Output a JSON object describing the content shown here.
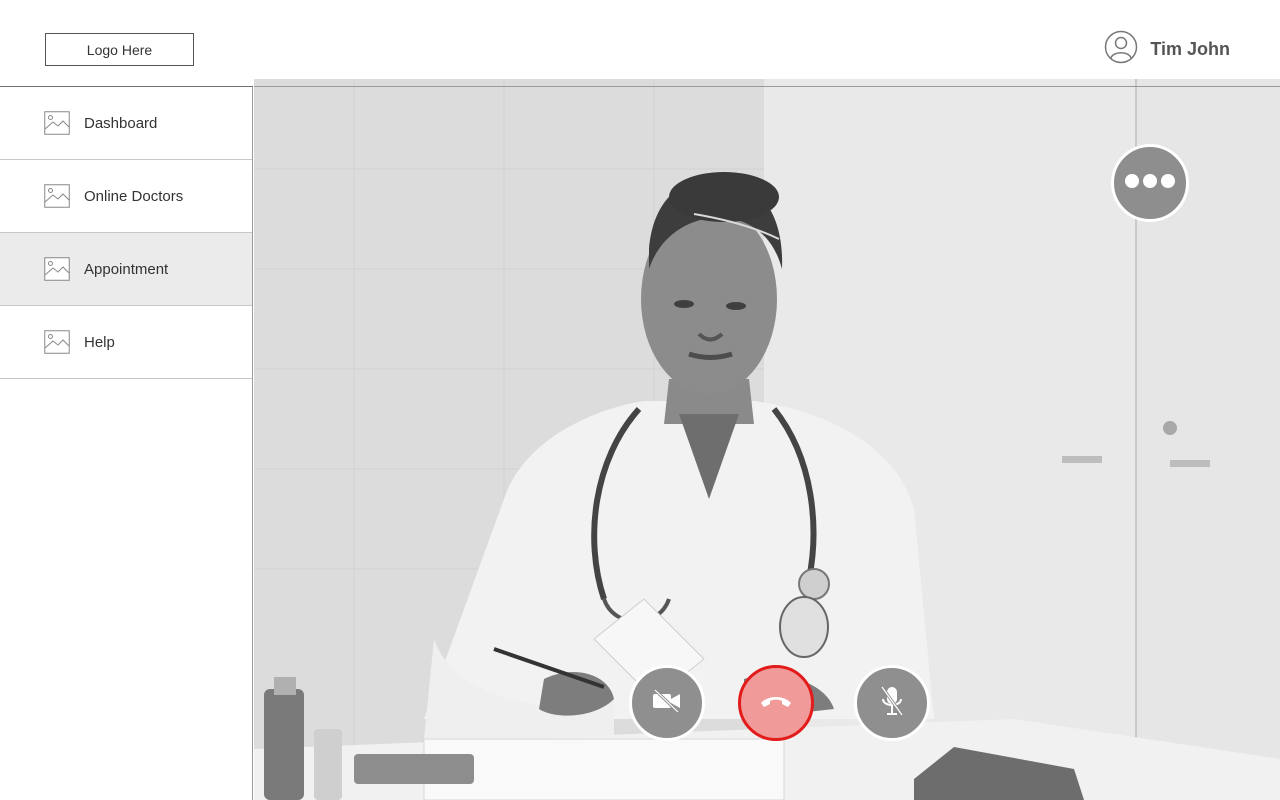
{
  "header": {
    "logo_text": "Logo Here",
    "user": {
      "name": "Tim John",
      "avatar_icon": "user-avatar-icon"
    }
  },
  "sidebar": {
    "items": [
      {
        "label": "Dashboard",
        "icon": "image-placeholder-icon",
        "active": false
      },
      {
        "label": "Online Doctors",
        "icon": "image-placeholder-icon",
        "active": false
      },
      {
        "label": "Appointment",
        "icon": "image-placeholder-icon",
        "active": true
      },
      {
        "label": "Help",
        "icon": "image-placeholder-icon",
        "active": false
      }
    ]
  },
  "call": {
    "more_icon": "more-options-icon",
    "controls": [
      {
        "id": "camera",
        "icon": "video-off-icon",
        "state": "off"
      },
      {
        "id": "hangup",
        "icon": "phone-hangup-icon"
      },
      {
        "id": "microphone",
        "icon": "mic-off-icon",
        "state": "muted"
      }
    ]
  },
  "colors": {
    "hangup_border": "#e21b1b",
    "hangup_fill": "#f19a9a",
    "control_fill": "#8f8f8f",
    "active_nav_bg": "#ebebeb"
  }
}
